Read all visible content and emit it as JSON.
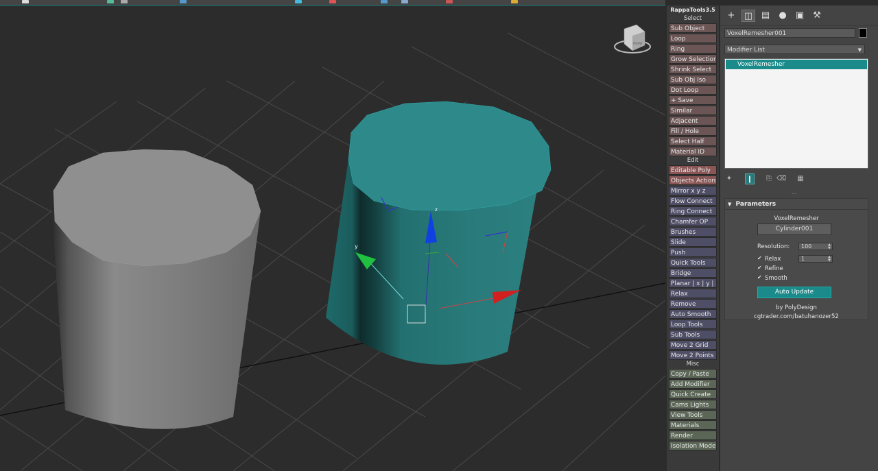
{
  "rappa": {
    "title": "RappaTools3.5",
    "sections": {
      "select": "Select",
      "edit": "Edit",
      "misc": "Misc"
    },
    "select_buttons": [
      "Sub Object",
      "Loop",
      "Ring",
      "Grow Selection",
      "Shrink Select",
      "Sub Obj Iso",
      "Dot Loop",
      "+ Save",
      "Similar",
      "Adjacent",
      "Fill / Hole",
      "Select Half",
      "Material ID"
    ],
    "edit_buttons": [
      "Editable Poly",
      "Objects Actions",
      "Mirror   x  y  z",
      "Flow Connect",
      "Ring Connect",
      "Chamfer OP",
      "Brushes",
      "Slide",
      "Push",
      "Quick Tools",
      "Bridge",
      "Planar | x | y | z",
      "Relax",
      "Remove",
      "Auto Smooth",
      "Loop Tools",
      "Sub Tools",
      "Move 2 Grid",
      "Move 2 Points"
    ],
    "misc_buttons": [
      "Copy / Paste",
      "Add Modifier",
      "Quick Create",
      "Cams Lights",
      "View Tools",
      "Materials",
      "Render",
      "Isolation Mode"
    ]
  },
  "command_panel": {
    "object_name": "VoxelRemesher001",
    "object_color": "#000000",
    "modifier_list_label": "Modifier List",
    "stack_items": [
      "VoxelRemesher"
    ],
    "parameters": {
      "header": "Parameters",
      "title": "VoxelRemesher",
      "pick_button": "Cylinder001",
      "resolution_label": "Resolution:",
      "resolution_value": "100",
      "relax_label": "Relax",
      "relax_checked": true,
      "relax_value": "1",
      "refine_label": "Refine",
      "refine_checked": true,
      "smooth_label": "Smooth",
      "smooth_checked": true,
      "auto_update_button": "Auto Update",
      "credit": "by PolyDesign",
      "url": "cgtrader.com/batuhanozer52"
    }
  },
  "viewcube": {
    "face_label": "FRONT"
  },
  "gizmo": {
    "y_label": "y",
    "z_label": "z"
  },
  "colors": {
    "accent": "#1a8a8a",
    "teal_object": "#2e8a8a",
    "viewport_bg": "#2c2c2c"
  }
}
